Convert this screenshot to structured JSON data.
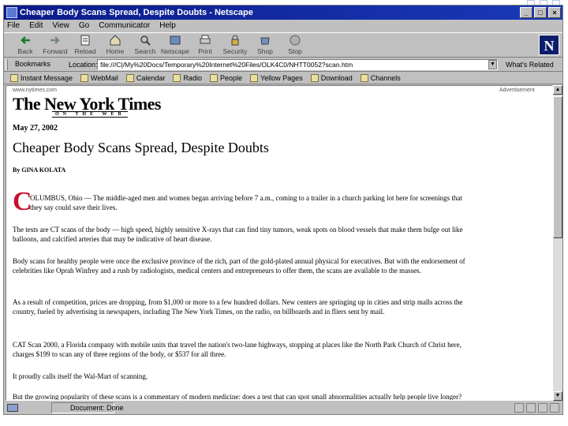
{
  "window": {
    "title": "Cheaper Body Scans Spread, Despite Doubts - Netscape",
    "min": "_",
    "max": "□",
    "close": "×"
  },
  "menu": [
    "File",
    "Edit",
    "View",
    "Go",
    "Communicator",
    "Help"
  ],
  "toolbar": [
    {
      "label": "Back",
      "icon": "back-arrow-icon"
    },
    {
      "label": "Forward",
      "icon": "forward-arrow-icon"
    },
    {
      "label": "Reload",
      "icon": "reload-icon"
    },
    {
      "label": "Home",
      "icon": "home-icon"
    },
    {
      "label": "Search",
      "icon": "search-icon"
    },
    {
      "label": "Netscape",
      "icon": "netscape-icon"
    },
    {
      "label": "Print",
      "icon": "print-icon"
    },
    {
      "label": "Security",
      "icon": "security-lock-icon"
    },
    {
      "label": "Shop",
      "icon": "shop-icon"
    },
    {
      "label": "Stop",
      "icon": "stop-icon"
    }
  ],
  "location": {
    "bookmarks": "Bookmarks",
    "label": "Location:",
    "value": "file:///C|/My%20Docs/Temporary%20Internet%20Files/OLK4C0/NHTT0052?scan.htm",
    "related": "What's Related"
  },
  "personal_toolbar": [
    "Instant Message",
    "WebMail",
    "Calendar",
    "Radio",
    "People",
    "Yellow Pages",
    "Download",
    "Channels"
  ],
  "article": {
    "site_url": "www.nytimes.com",
    "advertisement": "Advertisement",
    "logo": "The New York Times",
    "logo_sub": "ON THE WEB",
    "date": "May 27, 2002",
    "headline": "Cheaper Body Scans Spread, Despite Doubts",
    "byline": "By GINA KOLATA",
    "dropcap": "C",
    "paragraphs": [
      "OLUMBUS, Ohio — The middle-aged men and women began arriving before 7 a.m., coming to a trailer in a church parking lot here for screenings that they say could save their lives.",
      "The tests are CT scans of the body — high speed, highly sensitive X-rays that can find tiny tumors, weak spots on blood vessels that make them bulge out like balloons, and calcified arteries that may be indicative of heart disease.",
      "Body scans for healthy people were once the exclusive province of the rich, part of the gold-plated annual physical for executives. But with the endorsement of celebrities like Oprah Winfrey and a rush by radiologists, medical centers and entrepreneurs to offer them, the scans are available to the masses.",
      "As a result of competition, prices are dropping, from $1,000 or more to a few hundred dollars. New centers are springing up in cities and strip malls across the country, fueled by advertising in newspapers, including The New York Times, on the radio, on billboards and in fliers sent by mail.",
      "CAT Scan 2000, a Florida company with mobile units that travel the nation's two-lane highways, stopping at places like the North Park Church of Christ here, charges $199 to scan any of three regions of the body, or $537 for all three.",
      "It proudly calls itself the Wal-Mart of scanning.",
      "But the growing popularity of these scans is a commentary of modern medicine: does a test that can spot small abnormalities actually help people live longer?"
    ]
  },
  "status": {
    "text": "Document: Done"
  }
}
